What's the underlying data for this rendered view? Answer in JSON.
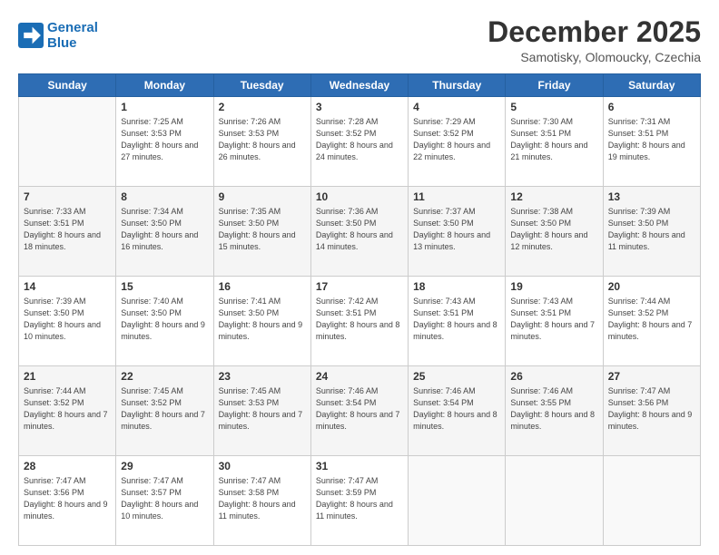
{
  "logo": {
    "line1": "General",
    "line2": "Blue"
  },
  "header": {
    "title": "December 2025",
    "subtitle": "Samotisky, Olomoucky, Czechia"
  },
  "weekdays": [
    "Sunday",
    "Monday",
    "Tuesday",
    "Wednesday",
    "Thursday",
    "Friday",
    "Saturday"
  ],
  "weeks": [
    [
      {
        "day": "",
        "sunrise": "",
        "sunset": "",
        "daylight": ""
      },
      {
        "day": "1",
        "sunrise": "Sunrise: 7:25 AM",
        "sunset": "Sunset: 3:53 PM",
        "daylight": "Daylight: 8 hours and 27 minutes."
      },
      {
        "day": "2",
        "sunrise": "Sunrise: 7:26 AM",
        "sunset": "Sunset: 3:53 PM",
        "daylight": "Daylight: 8 hours and 26 minutes."
      },
      {
        "day": "3",
        "sunrise": "Sunrise: 7:28 AM",
        "sunset": "Sunset: 3:52 PM",
        "daylight": "Daylight: 8 hours and 24 minutes."
      },
      {
        "day": "4",
        "sunrise": "Sunrise: 7:29 AM",
        "sunset": "Sunset: 3:52 PM",
        "daylight": "Daylight: 8 hours and 22 minutes."
      },
      {
        "day": "5",
        "sunrise": "Sunrise: 7:30 AM",
        "sunset": "Sunset: 3:51 PM",
        "daylight": "Daylight: 8 hours and 21 minutes."
      },
      {
        "day": "6",
        "sunrise": "Sunrise: 7:31 AM",
        "sunset": "Sunset: 3:51 PM",
        "daylight": "Daylight: 8 hours and 19 minutes."
      }
    ],
    [
      {
        "day": "7",
        "sunrise": "Sunrise: 7:33 AM",
        "sunset": "Sunset: 3:51 PM",
        "daylight": "Daylight: 8 hours and 18 minutes."
      },
      {
        "day": "8",
        "sunrise": "Sunrise: 7:34 AM",
        "sunset": "Sunset: 3:50 PM",
        "daylight": "Daylight: 8 hours and 16 minutes."
      },
      {
        "day": "9",
        "sunrise": "Sunrise: 7:35 AM",
        "sunset": "Sunset: 3:50 PM",
        "daylight": "Daylight: 8 hours and 15 minutes."
      },
      {
        "day": "10",
        "sunrise": "Sunrise: 7:36 AM",
        "sunset": "Sunset: 3:50 PM",
        "daylight": "Daylight: 8 hours and 14 minutes."
      },
      {
        "day": "11",
        "sunrise": "Sunrise: 7:37 AM",
        "sunset": "Sunset: 3:50 PM",
        "daylight": "Daylight: 8 hours and 13 minutes."
      },
      {
        "day": "12",
        "sunrise": "Sunrise: 7:38 AM",
        "sunset": "Sunset: 3:50 PM",
        "daylight": "Daylight: 8 hours and 12 minutes."
      },
      {
        "day": "13",
        "sunrise": "Sunrise: 7:39 AM",
        "sunset": "Sunset: 3:50 PM",
        "daylight": "Daylight: 8 hours and 11 minutes."
      }
    ],
    [
      {
        "day": "14",
        "sunrise": "Sunrise: 7:39 AM",
        "sunset": "Sunset: 3:50 PM",
        "daylight": "Daylight: 8 hours and 10 minutes."
      },
      {
        "day": "15",
        "sunrise": "Sunrise: 7:40 AM",
        "sunset": "Sunset: 3:50 PM",
        "daylight": "Daylight: 8 hours and 9 minutes."
      },
      {
        "day": "16",
        "sunrise": "Sunrise: 7:41 AM",
        "sunset": "Sunset: 3:50 PM",
        "daylight": "Daylight: 8 hours and 9 minutes."
      },
      {
        "day": "17",
        "sunrise": "Sunrise: 7:42 AM",
        "sunset": "Sunset: 3:51 PM",
        "daylight": "Daylight: 8 hours and 8 minutes."
      },
      {
        "day": "18",
        "sunrise": "Sunrise: 7:43 AM",
        "sunset": "Sunset: 3:51 PM",
        "daylight": "Daylight: 8 hours and 8 minutes."
      },
      {
        "day": "19",
        "sunrise": "Sunrise: 7:43 AM",
        "sunset": "Sunset: 3:51 PM",
        "daylight": "Daylight: 8 hours and 7 minutes."
      },
      {
        "day": "20",
        "sunrise": "Sunrise: 7:44 AM",
        "sunset": "Sunset: 3:52 PM",
        "daylight": "Daylight: 8 hours and 7 minutes."
      }
    ],
    [
      {
        "day": "21",
        "sunrise": "Sunrise: 7:44 AM",
        "sunset": "Sunset: 3:52 PM",
        "daylight": "Daylight: 8 hours and 7 minutes."
      },
      {
        "day": "22",
        "sunrise": "Sunrise: 7:45 AM",
        "sunset": "Sunset: 3:52 PM",
        "daylight": "Daylight: 8 hours and 7 minutes."
      },
      {
        "day": "23",
        "sunrise": "Sunrise: 7:45 AM",
        "sunset": "Sunset: 3:53 PM",
        "daylight": "Daylight: 8 hours and 7 minutes."
      },
      {
        "day": "24",
        "sunrise": "Sunrise: 7:46 AM",
        "sunset": "Sunset: 3:54 PM",
        "daylight": "Daylight: 8 hours and 7 minutes."
      },
      {
        "day": "25",
        "sunrise": "Sunrise: 7:46 AM",
        "sunset": "Sunset: 3:54 PM",
        "daylight": "Daylight: 8 hours and 8 minutes."
      },
      {
        "day": "26",
        "sunrise": "Sunrise: 7:46 AM",
        "sunset": "Sunset: 3:55 PM",
        "daylight": "Daylight: 8 hours and 8 minutes."
      },
      {
        "day": "27",
        "sunrise": "Sunrise: 7:47 AM",
        "sunset": "Sunset: 3:56 PM",
        "daylight": "Daylight: 8 hours and 9 minutes."
      }
    ],
    [
      {
        "day": "28",
        "sunrise": "Sunrise: 7:47 AM",
        "sunset": "Sunset: 3:56 PM",
        "daylight": "Daylight: 8 hours and 9 minutes."
      },
      {
        "day": "29",
        "sunrise": "Sunrise: 7:47 AM",
        "sunset": "Sunset: 3:57 PM",
        "daylight": "Daylight: 8 hours and 10 minutes."
      },
      {
        "day": "30",
        "sunrise": "Sunrise: 7:47 AM",
        "sunset": "Sunset: 3:58 PM",
        "daylight": "Daylight: 8 hours and 11 minutes."
      },
      {
        "day": "31",
        "sunrise": "Sunrise: 7:47 AM",
        "sunset": "Sunset: 3:59 PM",
        "daylight": "Daylight: 8 hours and 11 minutes."
      },
      {
        "day": "",
        "sunrise": "",
        "sunset": "",
        "daylight": ""
      },
      {
        "day": "",
        "sunrise": "",
        "sunset": "",
        "daylight": ""
      },
      {
        "day": "",
        "sunrise": "",
        "sunset": "",
        "daylight": ""
      }
    ]
  ]
}
